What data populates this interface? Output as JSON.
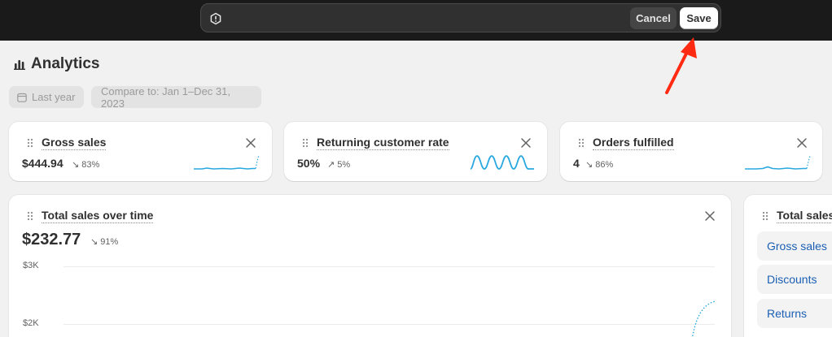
{
  "savebar": {
    "cancel_label": "Cancel",
    "save_label": "Save"
  },
  "page": {
    "title": "Analytics"
  },
  "filters": {
    "date_range": "Last year",
    "compare": "Compare to: Jan 1–Dec 31, 2023"
  },
  "cards": [
    {
      "title": "Gross sales",
      "value": "$444.94",
      "delta": "83%",
      "trend": "down"
    },
    {
      "title": "Returning customer rate",
      "value": "50%",
      "delta": "5%",
      "trend": "up"
    },
    {
      "title": "Orders fulfilled",
      "value": "4",
      "delta": "86%",
      "trend": "down"
    }
  ],
  "main_chart": {
    "title": "Total sales over time",
    "value": "$232.77",
    "delta": "91%",
    "trend": "down",
    "y_ticks": [
      "$3K",
      "$2K"
    ]
  },
  "side_panel": {
    "title": "Total sales",
    "items": [
      "Gross sales",
      "Discounts",
      "Returns"
    ]
  },
  "colors": {
    "accent_blue": "#1a5fb4",
    "spark_blue": "#29a8e0",
    "arrow_red": "#ff2a12"
  }
}
